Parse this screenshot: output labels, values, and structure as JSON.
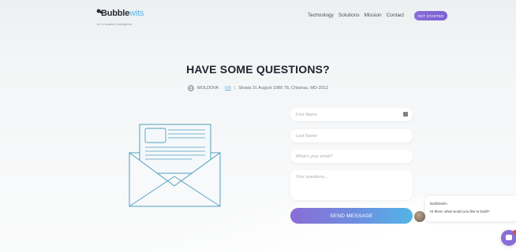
{
  "header": {
    "logo": {
      "name_bold": "Bubble",
      "name_accent": "wits",
      "tagline": "#1 in location intelligence"
    },
    "nav": [
      "Technology",
      "Solutions",
      "Mission",
      "Contact"
    ],
    "cta_label": "GET STARTED"
  },
  "main": {
    "title": "HAVE SOME QUESTIONS?",
    "address": {
      "country": "MOLDOVA",
      "link": "EN",
      "separator": "|",
      "street": "Strada 31 August 1989 78, Chisinau, MD-2012"
    }
  },
  "form": {
    "first_name_placeholder": "First Name",
    "last_name_placeholder": "Last Name",
    "email_placeholder": "What's your email?",
    "questions_placeholder": "Your questions...",
    "submit_label": "SEND MESSAGE"
  },
  "chat": {
    "agent_name": "Bubblewits",
    "message": "Hi there, what would you like to build?"
  },
  "colors": {
    "accent_purple": "#8a6cd6",
    "accent_blue": "#52b5e6",
    "illustration": "#4f9fbf"
  }
}
